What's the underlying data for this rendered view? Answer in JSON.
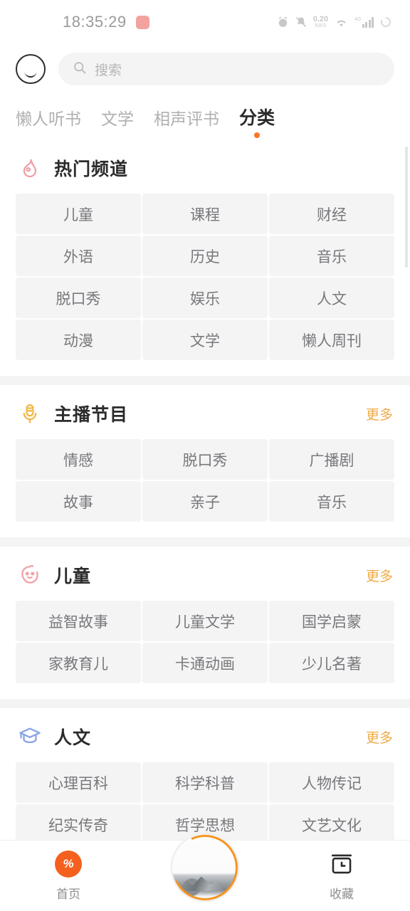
{
  "statusbar": {
    "time": "18:35:29",
    "badge_label": "",
    "network_speed_value": "0.20",
    "network_speed_unit": "KB/S",
    "wifi_label": "4G",
    "signal_label": "4G",
    "icons": [
      "alarm-icon",
      "bell-muted-icon",
      "network-speed",
      "wifi-icon",
      "signal-icon",
      "battery-icon"
    ]
  },
  "header": {
    "avatar_icon": "smiley-avatar-icon",
    "search": {
      "placeholder": "搜索",
      "icon": "search-icon"
    }
  },
  "tabs": [
    {
      "label": "懒人听书",
      "active": false
    },
    {
      "label": "文学",
      "active": false
    },
    {
      "label": "相声评书",
      "active": false
    },
    {
      "label": "分类",
      "active": true
    }
  ],
  "sections": [
    {
      "title": "热门频道",
      "icon": "flame-icon",
      "icon_color": "#f0a0a6",
      "more_label": "",
      "has_more": false,
      "chips": [
        "儿童",
        "课程",
        "财经",
        "外语",
        "历史",
        "音乐",
        "脱口秀",
        "娱乐",
        "人文",
        "动漫",
        "文学",
        "懒人周刊"
      ]
    },
    {
      "title": "主播节目",
      "icon": "microphone-icon",
      "icon_color": "#f3b642",
      "more_label": "更多",
      "has_more": true,
      "chips": [
        "情感",
        "脱口秀",
        "广播剧",
        "故事",
        "亲子",
        "音乐"
      ]
    },
    {
      "title": "儿童",
      "icon": "baby-face-icon",
      "icon_color": "#f0a0a6",
      "more_label": "更多",
      "has_more": true,
      "chips": [
        "益智故事",
        "儿童文学",
        "国学启蒙",
        "家教育儿",
        "卡通动画",
        "少儿名著"
      ]
    },
    {
      "title": "人文",
      "icon": "graduation-cap-icon",
      "icon_color": "#8ca6e8",
      "more_label": "更多",
      "has_more": true,
      "chips": [
        "心理百科",
        "科学科普",
        "人物传记",
        "纪实传奇",
        "哲学思想",
        "文艺文化"
      ]
    }
  ],
  "bottom_nav": {
    "home": {
      "label": "首页",
      "icon": "home-logo-icon"
    },
    "player": {
      "icon": "player-album-art",
      "ring_color": "#f5941f"
    },
    "favorites": {
      "label": "收藏",
      "icon": "history-box-icon"
    }
  },
  "colors": {
    "accent_orange": "#f5601f",
    "more_orange": "#f0aa45",
    "chip_bg": "#f4f4f5",
    "text_primary": "#2b2b2b",
    "text_muted": "#78787c"
  }
}
